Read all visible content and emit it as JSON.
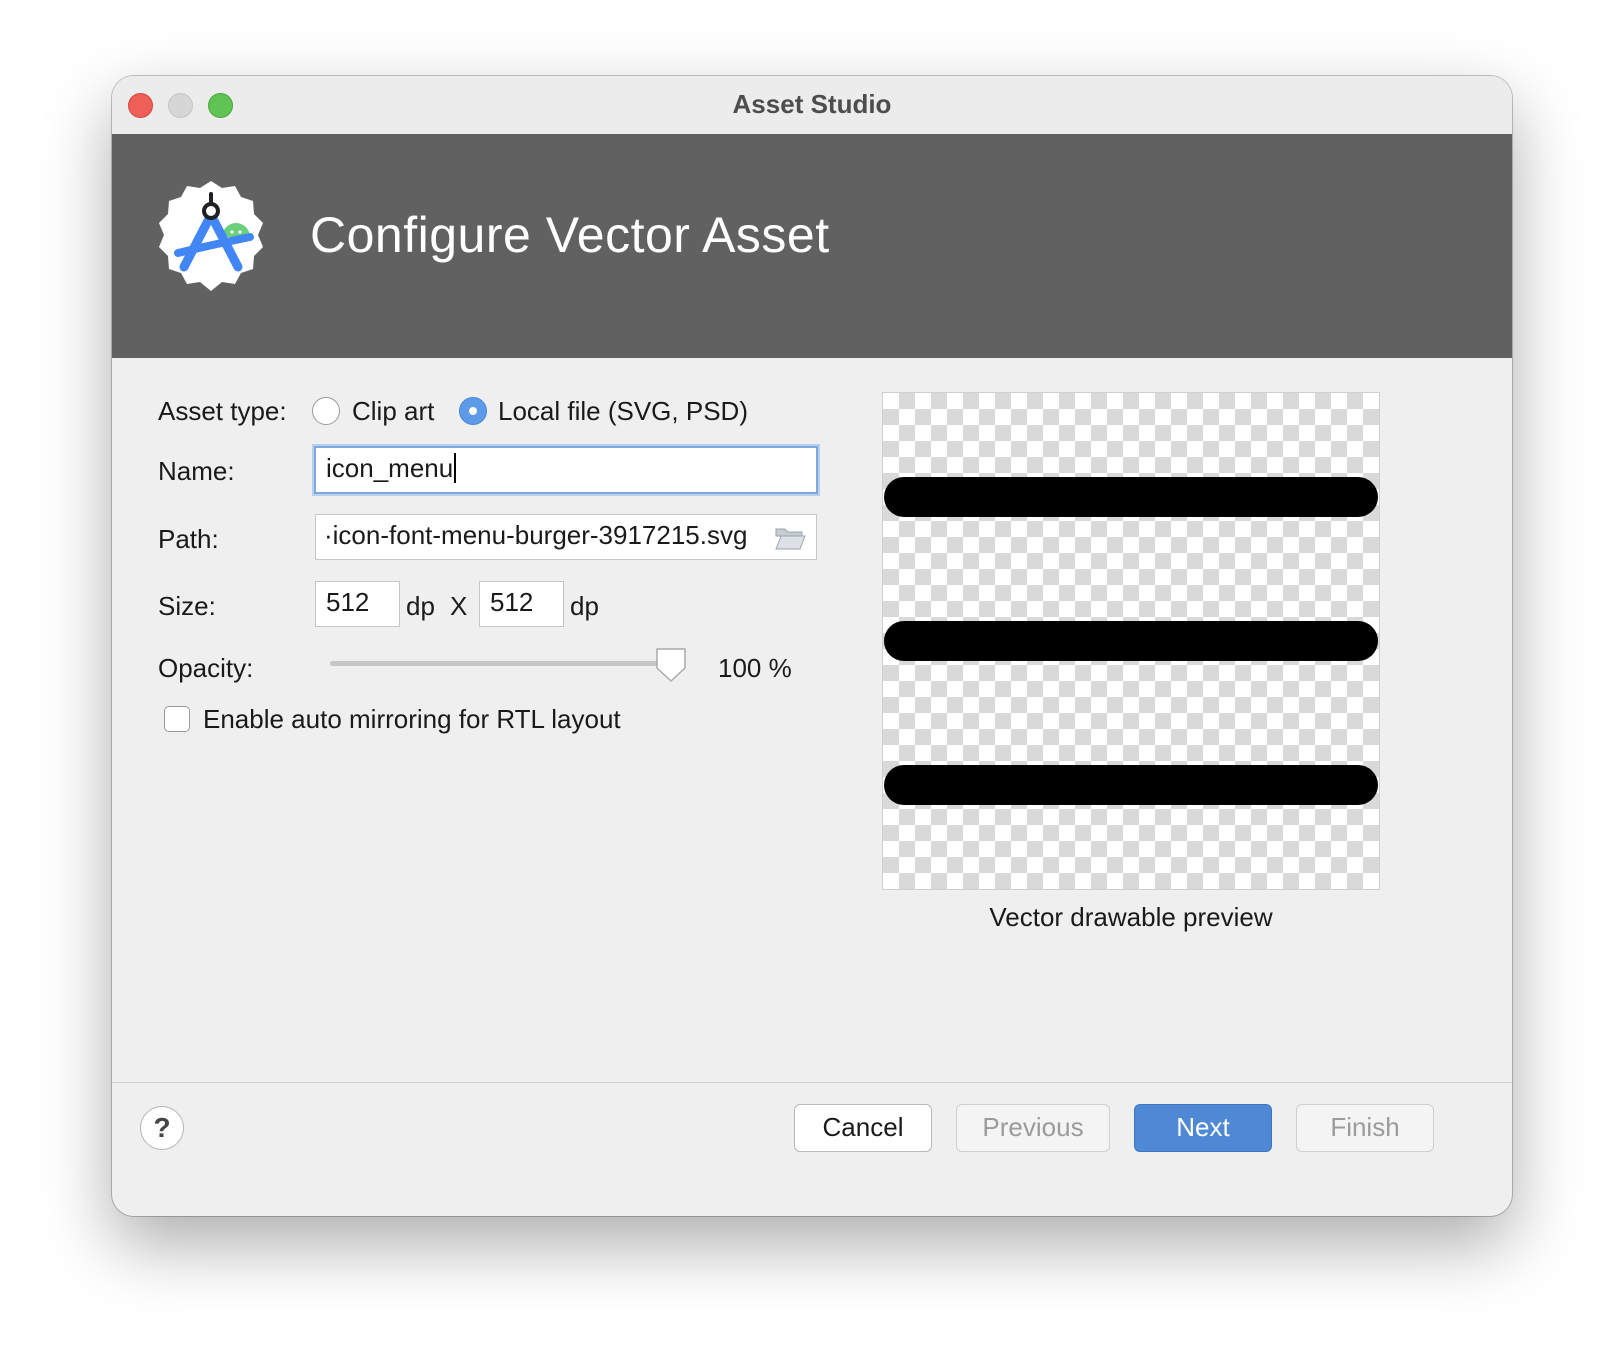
{
  "window": {
    "title": "Asset Studio"
  },
  "header": {
    "title": "Configure Vector Asset",
    "logo_icon": "android-studio-logo-icon"
  },
  "form": {
    "asset_type_label": "Asset type:",
    "asset_type_options": [
      {
        "label": "Clip art",
        "selected": false
      },
      {
        "label": "Local file (SVG, PSD)",
        "selected": true
      }
    ],
    "name_label": "Name:",
    "name_value": "icon_menu",
    "path_label": "Path:",
    "path_value": "·icon-font-menu-burger-3917215.svg",
    "path_icon": "folder-open-icon",
    "size_label": "Size:",
    "size_width": "512",
    "size_height": "512",
    "size_unit": "dp",
    "size_separator": "X",
    "opacity_label": "Opacity:",
    "opacity_value": 100,
    "opacity_text": "100 %",
    "auto_mirror_label": "Enable auto mirroring for RTL layout",
    "auto_mirror_checked": false
  },
  "preview": {
    "caption": "Vector drawable preview",
    "content_icon": "menu-burger-icon"
  },
  "footer": {
    "help_label": "?",
    "cancel_label": "Cancel",
    "previous_label": "Previous",
    "next_label": "Next",
    "finish_label": "Finish"
  },
  "colors": {
    "header_bg": "#616161",
    "primary_button": "#4f89d6",
    "radio_selected": "#5d9be8"
  }
}
